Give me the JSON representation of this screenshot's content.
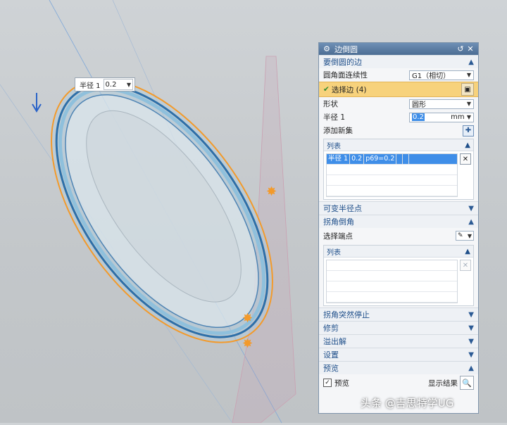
{
  "radius_popup": {
    "label": "半径 1",
    "value": "0.2"
  },
  "dialog": {
    "title": "边倒圆",
    "sections": {
      "edges": {
        "header": "要倒圆的边",
        "continuity_label": "圆角面连续性",
        "continuity_value": "G1（相切）",
        "select_edge": "选择边 (4)",
        "shape_label": "形状",
        "shape_value": "圆形",
        "radius_label": "半径 1",
        "radius_value": "0.2",
        "radius_unit": "mm",
        "add_set_label": "添加新集",
        "list_header": "列表",
        "list_row": [
          "半径 1",
          "0.2",
          "p69=0.2"
        ]
      },
      "variable_radius": "可变半径点",
      "corner": {
        "header": "拐角倒角",
        "select_endpoint": "选择端点",
        "list_header": "列表"
      },
      "corner_stop": "拐角突然停止",
      "trim": "修剪",
      "overflow": "溢出解",
      "settings": "设置",
      "preview": {
        "header": "预览",
        "checkbox_label": "预览",
        "show_result": "显示结果"
      }
    }
  },
  "watermark": "头条 @吉思特学UG",
  "colors": {
    "accent": "#3f8ee8",
    "selection": "#f7d27c",
    "edge_highlight": "#f39a2b"
  }
}
